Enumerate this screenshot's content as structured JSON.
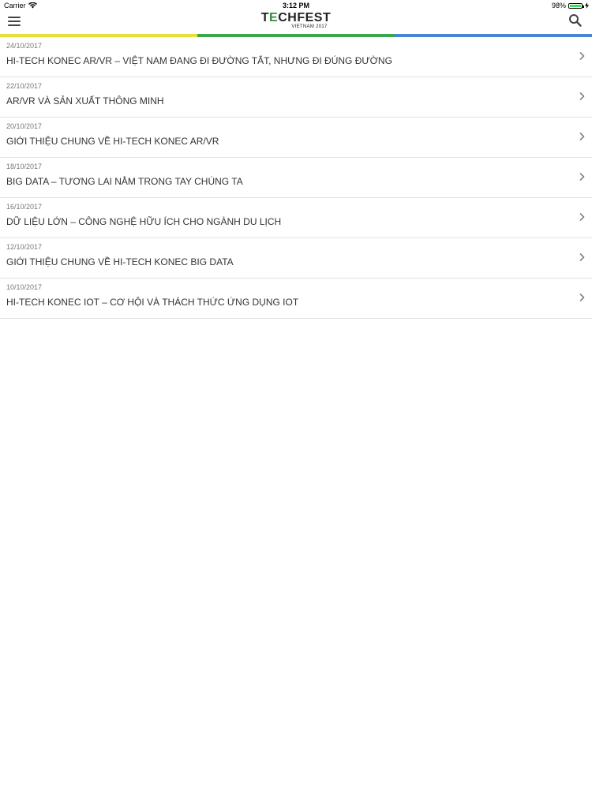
{
  "status_bar": {
    "carrier": "Carrier",
    "time": "3:12 PM",
    "battery": "98%",
    "battery_level": 0.98
  },
  "nav": {
    "logo_main_prefix": "T",
    "logo_main_accent": "E",
    "logo_main_suffix": "CHFEST",
    "logo_sub": "VIETNAM 2017"
  },
  "color_bar": {
    "colors": [
      "#e8e03a",
      "#3aa84a",
      "#4a84d6"
    ]
  },
  "icons": {
    "menu": "hamburger-menu-icon",
    "search": "search-icon",
    "chevron": "chevron-right-icon",
    "wifi": "wifi-icon",
    "battery": "battery-icon"
  },
  "articles": [
    {
      "date": "24/10/2017",
      "title": "HI-TECH KONEC AR/VR – VIỆT NAM ĐANG ĐI ĐƯỜNG TẮT, NHƯNG ĐI ĐÚNG ĐƯỜNG"
    },
    {
      "date": "22/10/2017",
      "title": "AR/VR VÀ SẢN XUẤT THÔNG MINH"
    },
    {
      "date": "20/10/2017",
      "title": "GIỚI THIỆU CHUNG VỀ HI-TECH KONEC AR/VR"
    },
    {
      "date": "18/10/2017",
      "title": "BIG DATA – TƯƠNG LAI NẰM TRONG TAY CHÚNG TA"
    },
    {
      "date": "16/10/2017",
      "title": "DỮ LIỆU LỚN – CÔNG NGHỆ HỮU ÍCH CHO NGÀNH DU LỊCH"
    },
    {
      "date": "12/10/2017",
      "title": "GIỚI THIỆU CHUNG VỀ HI-TECH KONEC BIG DATA"
    },
    {
      "date": "10/10/2017",
      "title": "HI-TECH KONEC IOT – CƠ HỘI VÀ THÁCH THỨC ỨNG DỤNG IOT"
    }
  ]
}
